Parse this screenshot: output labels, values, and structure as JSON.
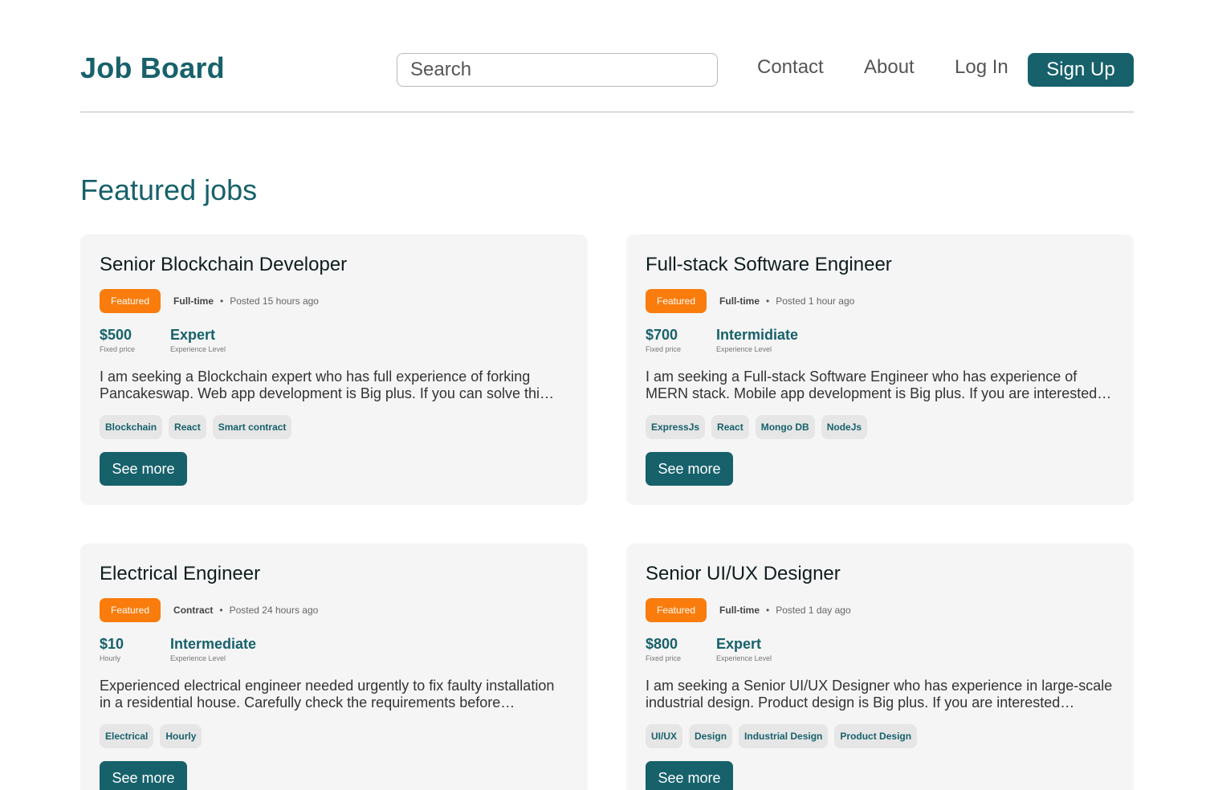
{
  "header": {
    "logo": "Job Board",
    "search_placeholder": "Search",
    "nav": {
      "contact": "Contact",
      "about": "About",
      "login": "Log In"
    },
    "signup_label": "Sign Up"
  },
  "section_title": "Featured jobs",
  "colors": {
    "brand": "#17616b",
    "featured_badge": "#f97c0c",
    "card_bg": "#f5f5f5"
  },
  "jobs": [
    {
      "title": "Senior Blockchain Developer",
      "badge": "Featured",
      "type": "Full-time",
      "posted": "Posted 15 hours ago",
      "price": "$500",
      "price_label": "Fixed price",
      "level": "Expert",
      "level_label": "Experience Level",
      "description": "I am seeking a Blockchain expert who has full experience of forking Pancakeswap. Web app development is Big plus. If you can solve thi…",
      "tags": [
        "Blockchain",
        "React",
        "Smart contract"
      ],
      "cta": "See more"
    },
    {
      "title": "Full-stack Software Engineer",
      "badge": "Featured",
      "type": "Full-time",
      "posted": "Posted 1 hour ago",
      "price": "$700",
      "price_label": "Fixed price",
      "level": "Intermidiate",
      "level_label": "Experience Level",
      "description": "I am seeking a Full-stack Software Engineer who has experience of MERN stack. Mobile app development is Big plus. If you are interested…",
      "tags": [
        "ExpressJs",
        "React",
        "Mongo DB",
        "NodeJs"
      ],
      "cta": "See more"
    },
    {
      "title": "Electrical Engineer",
      "badge": "Featured",
      "type": "Contract",
      "posted": "Posted 24 hours ago",
      "price": "$10",
      "price_label": "Hourly",
      "level": "Intermediate",
      "level_label": "Experience Level",
      "description": "Experienced electrical engineer needed urgently to fix faulty installation in a residential house. Carefully check the requirements before applying…",
      "tags": [
        "Electrical",
        "Hourly"
      ],
      "cta": "See more"
    },
    {
      "title": "Senior UI/UX Designer",
      "badge": "Featured",
      "type": "Full-time",
      "posted": "Posted 1 day ago",
      "price": "$800",
      "price_label": "Fixed price",
      "level": "Expert",
      "level_label": "Experience Level",
      "description": "I am seeking a Senior UI/UX Designer who has experience in large-scale industrial design. Product design is Big plus. If you are interested…",
      "tags": [
        "UI/UX",
        "Design",
        "Industrial Design",
        "Product Design"
      ],
      "cta": "See more"
    }
  ]
}
